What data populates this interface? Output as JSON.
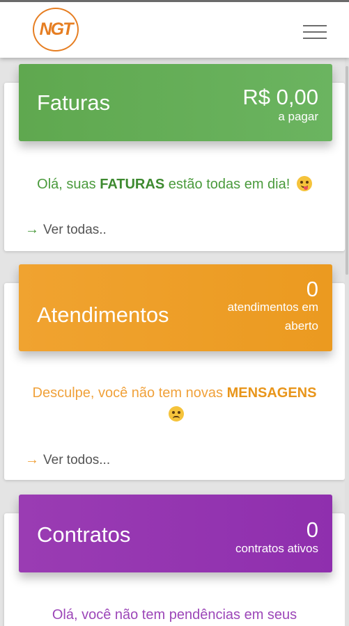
{
  "header": {
    "logo_text": "NGT",
    "menu_icon": "hamburger-menu-icon"
  },
  "cards": [
    {
      "title": "Faturas",
      "value": "R$ 0,00",
      "sub": "a pagar",
      "message_pre": "Olá, suas ",
      "message_bold": "FATURAS",
      "message_post": " estão todas em dia!",
      "emoji": "tongue-emoji",
      "link": "Ver todas..",
      "color": "#62ad54",
      "text_color": "#4a9a3c"
    },
    {
      "title": "Atendimentos",
      "value": "0",
      "sub": "atendimentos em aberto",
      "message_pre": "Desculpe, você não tem novas ",
      "message_bold": "MENSAGENS",
      "message_post": "",
      "emoji": "sad-emoji",
      "link": "Ver todos...",
      "color": "#ee9f28",
      "text_color": "#f0a13a"
    },
    {
      "title": "Contratos",
      "value": "0",
      "sub": "contratos ativos",
      "message_pre": "Olá, você não tem pendências em seus",
      "message_bold": "",
      "message_post": "",
      "link": "",
      "color": "#9437b0",
      "text_color": "#9c46b8"
    }
  ]
}
